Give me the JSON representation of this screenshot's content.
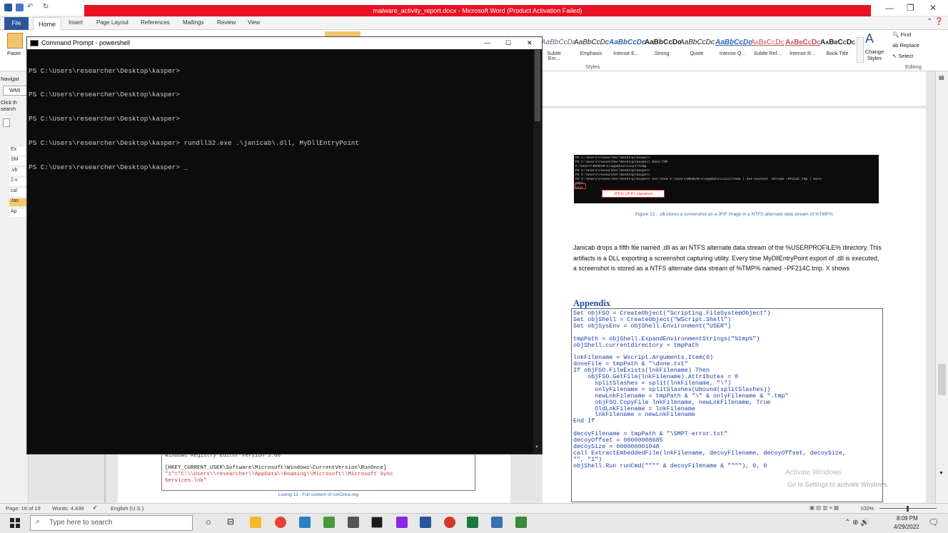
{
  "word": {
    "title": "malware_activity_report.docx  -  Microsoft Word (Product Activation Failed)",
    "tabs": [
      "File",
      "Home",
      "Insert",
      "Page Layout",
      "References",
      "Mailings",
      "Review",
      "View"
    ],
    "styles": [
      {
        "preview": "AaBbCcDc",
        "name": "Subtle Em..."
      },
      {
        "preview": "AaBbCcDc",
        "name": "Emphasis"
      },
      {
        "preview": "AaBbCcDc",
        "name": "Intense E..."
      },
      {
        "preview": "AaBbCcDc",
        "name": "Strong"
      },
      {
        "preview": "AaBbCcDc",
        "name": "Quote"
      },
      {
        "preview": "AaBbCcDc",
        "name": "Intense Q..."
      },
      {
        "preview": "AaBbCcDc",
        "name": "Subtle Ref..."
      },
      {
        "preview": "AaBbCcDc",
        "name": "Intense R..."
      },
      {
        "preview": "AaBbCcDc",
        "name": "Book Title"
      }
    ],
    "styles_group": "Styles",
    "change_styles": "Change Styles",
    "find": "Find",
    "replace": "Replace",
    "select": "Select",
    "editing_group": "Editing",
    "paste": "Paste",
    "nav_title": "Navigat",
    "nav_search": "WMI",
    "nav_hint": "Click th search",
    "nav_items": [
      "Ex",
      "SM",
      ".vb",
      "2.v",
      "cal",
      "Jan",
      "Ap"
    ]
  },
  "cmd": {
    "title": "Command Prompt - powershell",
    "lines": [
      "PS C:\\Users\\researcher\\Desktop\\kasper>",
      "PS C:\\Users\\researcher\\Desktop\\kasper>",
      "PS C:\\Users\\researcher\\Desktop\\kasper>",
      "PS C:\\Users\\researcher\\Desktop\\kasper> rundll32.exe .\\janicab\\.dll, MyDllEntryPoint",
      "PS C:\\Users\\researcher\\Desktop\\kasper> _"
    ],
    "min": "—",
    "max": "☐",
    "close": "✕"
  },
  "doc": {
    "figure_caption": "Figure 12 - .dll stores a screenshot as a JFIF image in a NTFS alternate data stream of %TMP%",
    "jfif_label": "JPEG (JFIF) signature",
    "paragraph": "Janicab drops a fifth file named .dll as an NTFS alternate data stream of the %USERPROFILE% directory. This artifacts is a DLL exporting a screenshot capturing utility. Every time MyDllEntryPoint export of .dll is executed, a screenshot is stored as a NTFS alternate data stream of %TMP% named ~PF214C.tmp. X shows",
    "appendix_heading": "Appendix",
    "code_lines": [
      "Set objFSO = CreateObject(\"Scripting.FileSystemObject\")",
      "Set objShell = CreateObject(\"WScript.Shell\")",
      "Set objSysEnv = objShell.Environment(\"USER\")",
      "",
      "tmpPath = objShell.ExpandEnvironmentStrings(\"%tmp%\")",
      "objShell.currentdirectory = tmpPath",
      "",
      "lnkFilename = Wscript.Arguments.Item(0)",
      "doneFile = tmpPath & \"\\done.txt\"",
      "If objFSO.FileExists(lnkFilename) Then",
      "    objFSO.GetFile(lnkFilename).Attributes = 0",
      "      splitSlashes = split(lnkFilename, \"\\\")",
      "      onlyFilename = splitSlashes(Ubound(splitSlashes))",
      "      newLnkFilename = tmpPath & \"\\\" & onlyFilename & \".tmp\"",
      "      objFSO.CopyFile lnkFilename, newLnkFilename, True",
      "      OldLnkFilename = lnkFilename",
      "      lnkFilename = newLnkFilename",
      "End If",
      "",
      "decoyFilename = tmpPath & \"\\SMPT-error.txt\"",
      "decoyOffset = 00000008685",
      "decoySize = 000000001048",
      "call ExtractEmbeddedFile(lnkFilename, decoyFilename, decoyOffset, decoySize,",
      "\"\", \"1\")",
      "objShell.Run runCmd(\"\"\"\" & decoyFilename & \"\"\"\"), 0, 0"
    ],
    "reg_lines": [
      "Windows Registry Editor Version 5.00",
      "",
      "[HKEY_CURRENT_USER\\Software\\Microsoft\\Windows\\CurrentVersion\\RunOnce]",
      "\"1\"=\"C:\\\\Users\\\\researcher\\\\AppData\\\\Roaming\\\\Microsoft\\\\Microsoft Sync",
      "Services.lnk\""
    ],
    "listing_caption": "Listing 13 - Full content of runOnce.reg",
    "activate1": "Activate Windows",
    "activate2": "Go to Settings to activate Windows."
  },
  "status": {
    "page": "Page: 16 of 19",
    "words": "Words: 4,439",
    "lang": "English (U.S.)",
    "zoom": "100%"
  },
  "taskbar": {
    "search_placeholder": "Type here to search",
    "time": "8:09 PM",
    "date": "4/29/2022"
  },
  "colors": {
    "red_title": "#e81123",
    "word_blue": "#2b579a",
    "cmd_bg": "#0c0c0c",
    "appendix": "#1f4e9e"
  }
}
